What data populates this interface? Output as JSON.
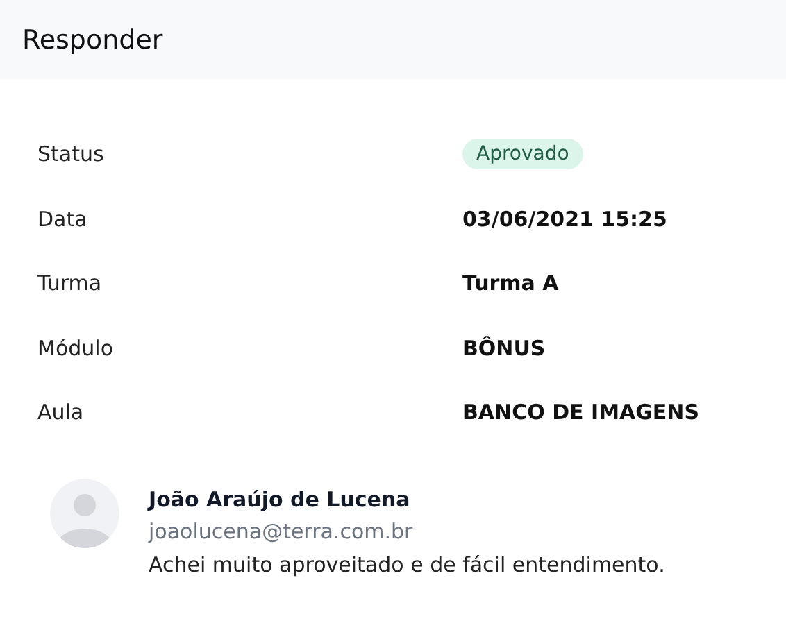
{
  "header": {
    "title": "Responder"
  },
  "details": [
    {
      "label": "Status",
      "value": "Aprovado",
      "kind": "badge"
    },
    {
      "label": "Data",
      "value": "03/06/2021 15:25",
      "kind": "text"
    },
    {
      "label": "Turma",
      "value": "Turma A",
      "kind": "text"
    },
    {
      "label": "Módulo",
      "value": "BÔNUS",
      "kind": "text"
    },
    {
      "label": "Aula",
      "value": "BANCO DE IMAGENS",
      "kind": "text"
    }
  ],
  "comment": {
    "author": "João Araújo de Lucena",
    "email": "joaolucena@terra.com.br",
    "text": "Achei muito aproveitado e de fácil entendimento."
  }
}
